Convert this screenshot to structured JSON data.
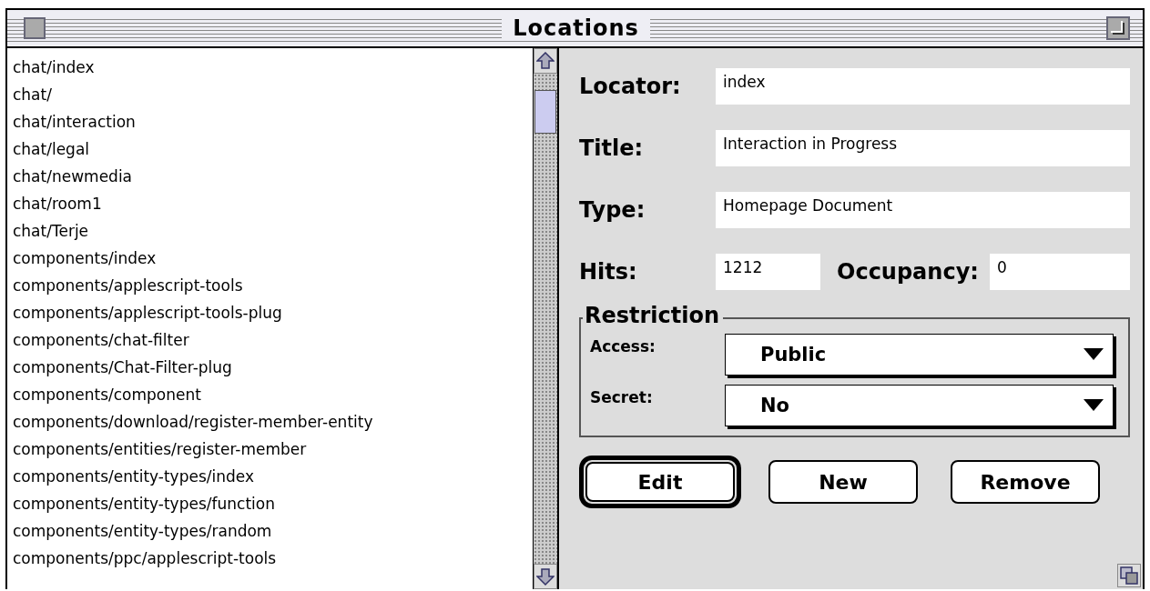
{
  "window": {
    "title": "Locations"
  },
  "list": {
    "items": [
      "chat/index",
      "chat/",
      "chat/interaction",
      "chat/legal",
      "chat/newmedia",
      "chat/room1",
      "chat/Terje",
      "components/index",
      "components/applescript-tools",
      "components/applescript-tools-plug",
      "components/chat-filter",
      "components/Chat-Filter-plug",
      "components/component",
      "components/download/register-member-entity",
      "components/entities/register-member",
      "components/entity-types/index",
      "components/entity-types/function",
      "components/entity-types/random",
      "components/ppc/applescript-tools"
    ]
  },
  "form": {
    "locator": {
      "label": "Locator:",
      "value": "index"
    },
    "title": {
      "label": "Title:",
      "value": "Interaction in Progress"
    },
    "type": {
      "label": "Type:",
      "value": "Homepage Document"
    },
    "hits": {
      "label": "Hits:",
      "value": "1212"
    },
    "occupancy": {
      "label": "Occupancy:",
      "value": "0"
    }
  },
  "restriction": {
    "title": "Restriction",
    "popups": [
      {
        "label": "Access:",
        "value": "Public"
      },
      {
        "label": "Secret:",
        "value": "No"
      }
    ]
  },
  "buttons": [
    {
      "label": "Edit",
      "default": true
    },
    {
      "label": "New",
      "default": false
    },
    {
      "label": "Remove",
      "default": false
    }
  ]
}
